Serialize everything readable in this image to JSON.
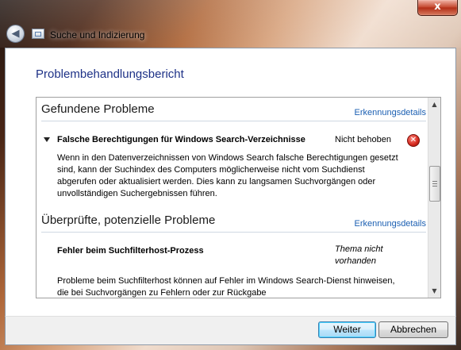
{
  "window": {
    "title": "Suche und Indizierung",
    "close_label": "x"
  },
  "page": {
    "heading": "Problembehandlungsbericht"
  },
  "found_section": {
    "heading": "Gefundene Probleme",
    "link": "Erkennungsdetails",
    "problem": {
      "title": "Falsche Berechtigungen für Windows Search-Verzeichnisse",
      "status": "Nicht behoben",
      "status_icon": "error-icon",
      "description": "Wenn in den Datenverzeichnissen von Windows Search falsche Berechtigungen gesetzt sind, kann der Suchindex des Computers möglicherweise nicht vom Suchdienst abgerufen oder aktualisiert werden. Dies kann zu langsamen Suchvorgängen oder unvollständigen Suchergebnissen führen."
    }
  },
  "checked_section": {
    "heading": "Überprüfte, potenzielle Probleme",
    "link": "Erkennungsdetails",
    "problem": {
      "title": "Fehler beim Suchfilterhost-Prozess",
      "status": "Thema nicht vorhanden",
      "description": "Probleme beim Suchfilterhost können auf Fehler im Windows Search-Dienst hinweisen, die bei Suchvorgängen zu Fehlern oder zur Rückgabe"
    }
  },
  "buttons": {
    "next_label": "Weiter",
    "cancel_label": "Abbrechen"
  }
}
